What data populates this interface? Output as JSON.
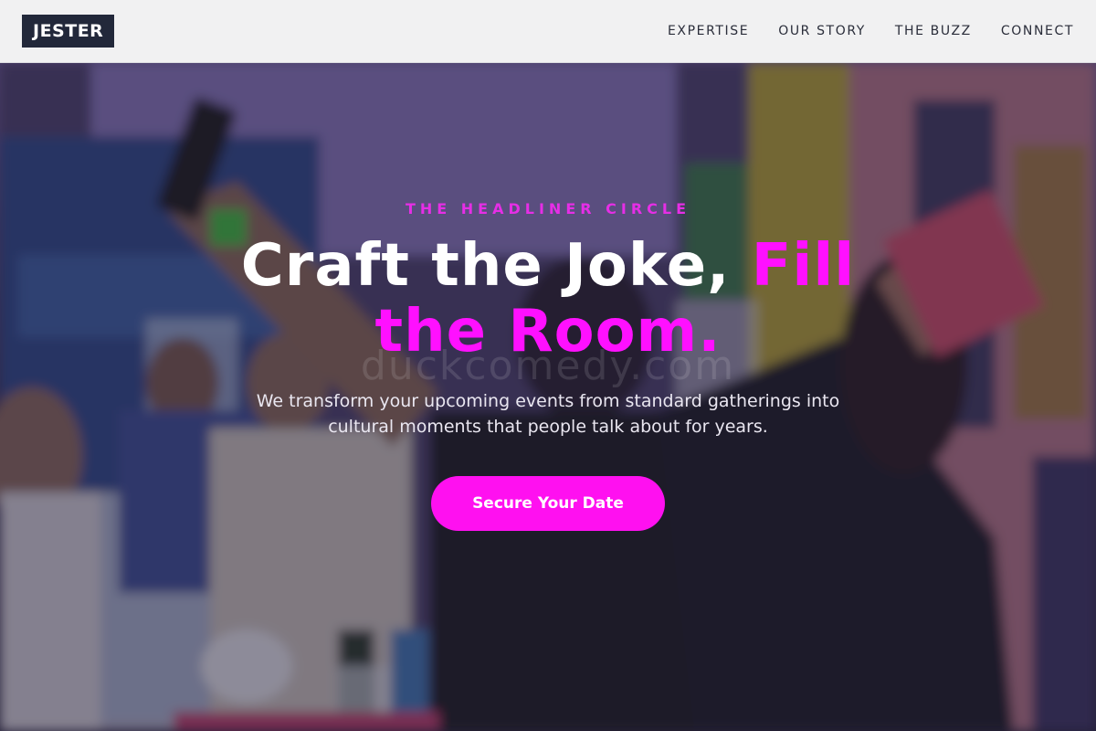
{
  "header": {
    "logo": "JESTER",
    "nav": [
      "EXPERTISE",
      "OUR STORY",
      "THE BUZZ",
      "CONNECT"
    ]
  },
  "hero": {
    "eyebrow": "THE HEADLINER CIRCLE",
    "headline_main": "Craft the Joke, ",
    "headline_accent": "Fill the Room.",
    "watermark": "duckcomedy.com",
    "description": "We transform your upcoming events from standard gatherings into cultural moments that people talk about for years.",
    "cta_label": "Secure Your Date",
    "background_scene": "crowd-selfie-photo"
  },
  "colors": {
    "accent": "#ff10ff",
    "header_bg": "#f1f1f2",
    "logo_bg": "#22283a"
  }
}
